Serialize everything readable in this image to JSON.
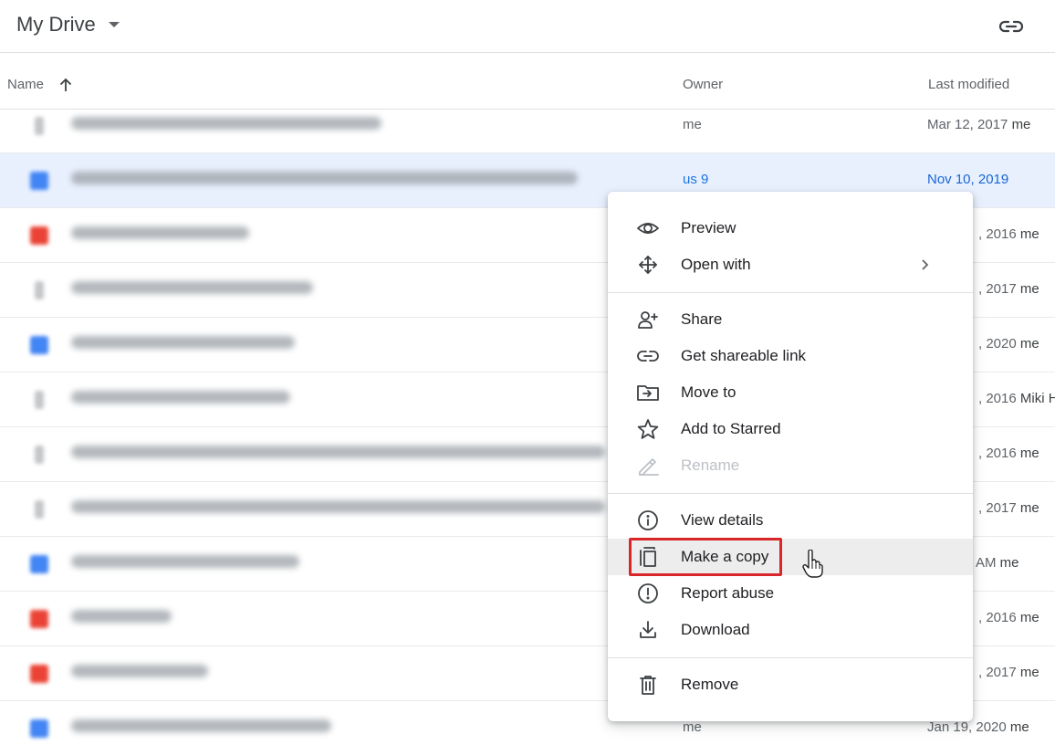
{
  "header": {
    "title": "My Drive"
  },
  "columns": {
    "name": "Name",
    "owner": "Owner",
    "last_modified": "Last modified"
  },
  "rows": [
    {
      "icon": "file-icon",
      "owner": "me",
      "modified": "Mar 12, 2017",
      "modified_by": "me"
    },
    {
      "icon": "doc-icon",
      "owner": "us 9",
      "modified": "Nov 10, 2019",
      "modified_by": "",
      "selected": true
    },
    {
      "icon": "pdf-icon",
      "owner": "",
      "modified": ", 2016",
      "modified_by": "me"
    },
    {
      "icon": "file-icon",
      "owner": "",
      "modified": ", 2017",
      "modified_by": "me"
    },
    {
      "icon": "doc-icon",
      "owner": "",
      "modified": ", 2020",
      "modified_by": "me"
    },
    {
      "icon": "file-icon",
      "owner": "",
      "modified": ", 2016",
      "modified_by": "Miki H"
    },
    {
      "icon": "file-icon",
      "owner": "",
      "modified": ", 2016",
      "modified_by": "me"
    },
    {
      "icon": "file-icon",
      "owner": "",
      "modified": ", 2017",
      "modified_by": "me"
    },
    {
      "icon": "doc-icon",
      "owner": "",
      "modified": "AM",
      "modified_by": "me"
    },
    {
      "icon": "pdf-icon",
      "owner": "",
      "modified": ", 2016",
      "modified_by": "me"
    },
    {
      "icon": "pdf-icon",
      "owner": "",
      "modified": ", 2017",
      "modified_by": "me"
    },
    {
      "icon": "doc-icon",
      "owner": "me",
      "modified": "Jan 19, 2020",
      "modified_by": "me"
    }
  ],
  "context_menu": {
    "items": [
      {
        "label": "Preview",
        "icon": "eye-icon"
      },
      {
        "label": "Open with",
        "icon": "move-arrows-icon"
      },
      {
        "label": "Share",
        "icon": "add-person-icon"
      },
      {
        "label": "Get shareable link",
        "icon": "link-icon"
      },
      {
        "label": "Move to",
        "icon": "folder-move-icon"
      },
      {
        "label": "Add to Starred",
        "icon": "star-icon"
      },
      {
        "label": "Rename",
        "icon": "pencil-icon",
        "disabled": true
      },
      {
        "label": "View details",
        "icon": "info-icon"
      },
      {
        "label": "Make a copy",
        "icon": "copy-icon",
        "hovered": true
      },
      {
        "label": "Report abuse",
        "icon": "report-icon"
      },
      {
        "label": "Download",
        "icon": "download-icon"
      },
      {
        "label": "Remove",
        "icon": "trash-icon"
      }
    ]
  },
  "colors": {
    "selected_row": "#e8f0fe",
    "highlight_box": "#d9262b",
    "doc_blue": "#4285f4",
    "pdf_red": "#ea4335"
  }
}
